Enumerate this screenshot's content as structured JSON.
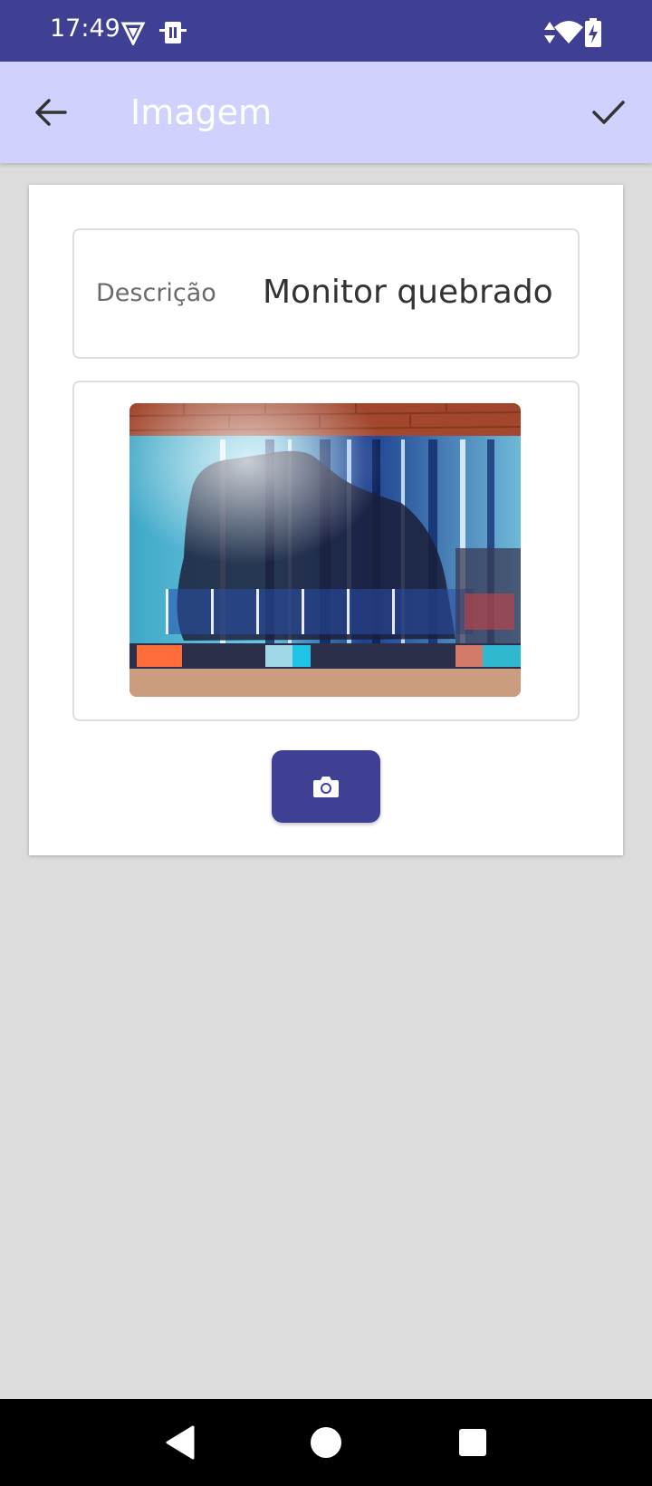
{
  "status_bar": {
    "time": "17:49",
    "icons": [
      "vpn-shield-icon",
      "sim-card-icon",
      "data-arrows-icon",
      "wifi-icon",
      "battery-charging-icon"
    ]
  },
  "app_bar": {
    "title": "Imagem",
    "back_icon": "arrow-left-icon",
    "confirm_icon": "check-icon"
  },
  "form": {
    "description_label": "Descrição",
    "description_value": "Monitor quebrado",
    "image": "photo of broken monitor with vertical blue lines",
    "camera_icon": "camera-icon"
  },
  "colors": {
    "primary": "#3f3f94",
    "app_bar": "#d0d1fd",
    "background": "#dcdcdc"
  },
  "nav_bar": {
    "icons": [
      "back-triangle-icon",
      "home-circle-icon",
      "recents-square-icon"
    ]
  }
}
